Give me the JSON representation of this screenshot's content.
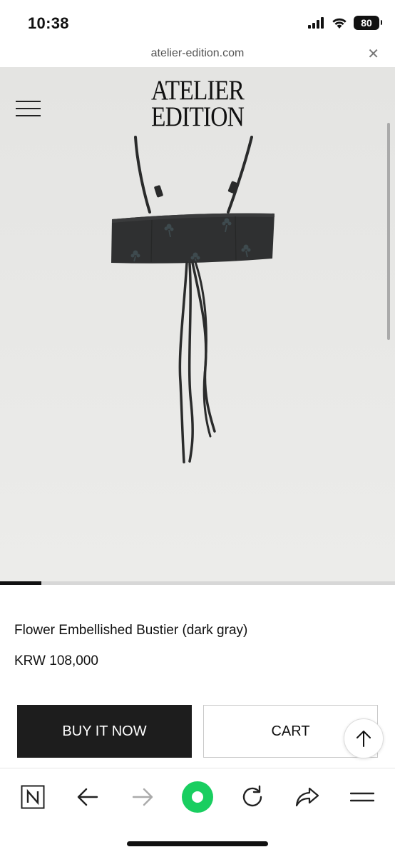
{
  "status_bar": {
    "time": "10:38",
    "battery": "80",
    "icons": [
      "cellular-signal-icon",
      "wifi-icon",
      "battery-icon"
    ]
  },
  "browser": {
    "url": "atelier-edition.com",
    "close_icon": "close-icon",
    "close_glyph": "✕"
  },
  "header": {
    "logo_line1": "ATELIER",
    "logo_line2": "EDITION",
    "menu_icon": "hamburger-menu-icon"
  },
  "gallery": {
    "image_subject": "dark gray bustier with flower embellishments and long ties",
    "progress": 0.105
  },
  "product": {
    "name": "Flower Embellished Bustier (dark gray)",
    "price": "KRW 108,000"
  },
  "actions": {
    "buy_label": "BUY IT NOW",
    "cart_label": "CART",
    "scroll_top_icon": "arrow-up-icon"
  },
  "toolbar": {
    "items": [
      "naver-icon",
      "back-arrow-icon",
      "forward-arrow-icon",
      "green-dot-icon",
      "reload-icon",
      "share-icon",
      "menu-icon"
    ],
    "accent_color": "#19ce60"
  }
}
